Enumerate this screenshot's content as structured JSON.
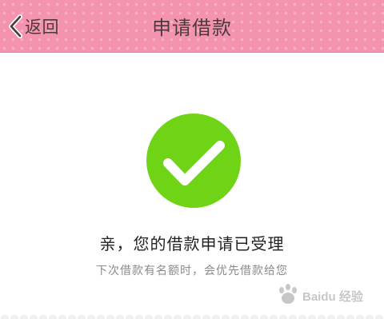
{
  "header": {
    "back_label": "返回",
    "title": "申请借款"
  },
  "result": {
    "icon": "check-circle-icon",
    "title": "亲，您的借款申请已受理",
    "subtitle": "下次借款有名额时，会优先借款给您"
  },
  "watermark": {
    "text": "Baidu 经验"
  },
  "colors": {
    "header_bg": "#f493ad",
    "success_green": "#6fd416",
    "text_dark": "#222222",
    "text_muted": "#8a8a8a"
  }
}
